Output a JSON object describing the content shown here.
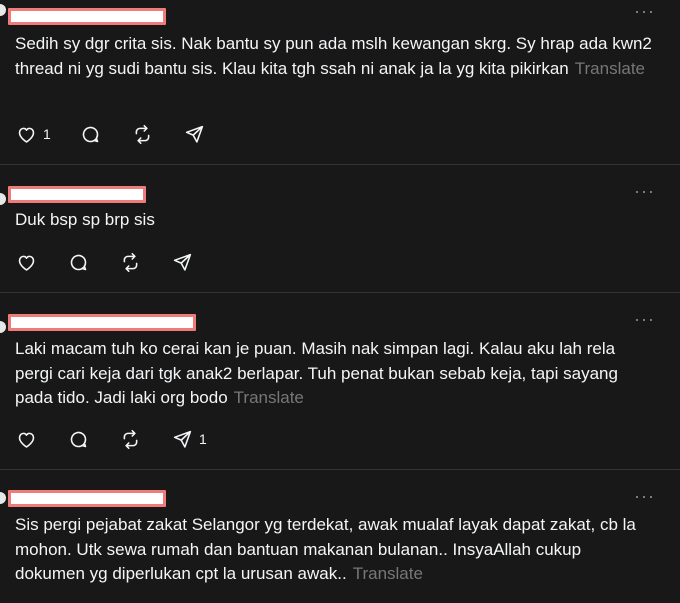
{
  "posts": [
    {
      "text": "Sedih sy dgr crita sis. Nak bantu sy pun ada mslh kewangan skrg. Sy hrap ada kwn2 thread ni yg sudi bantu sis. Klau kita tgh ssah ni anak ja la yg kita pikirkan",
      "translate": "Translate",
      "like_count": "1",
      "repost_count": "",
      "share_count": ""
    },
    {
      "text": "Duk bsp sp brp sis",
      "translate": "",
      "like_count": "",
      "share_count": ""
    },
    {
      "text": "Laki macam tuh ko cerai kan je puan. Masih nak simpan lagi. Kalau aku lah rela pergi cari keja dari tgk anak2 berlapar. Tuh penat bukan sebab keja, tapi sayang pada tido. Jadi laki org bodo",
      "translate": "Translate",
      "like_count": "",
      "share_count": "1"
    },
    {
      "text": "Sis pergi pejabat zakat Selangor yg terdekat, awak mualaf layak dapat zakat, cb la mohon. Utk sewa rumah dan bantuan makanan bulanan.. InsyaAllah cukup dokumen yg diperlukan cpt la urusan awak..",
      "translate": "Translate"
    }
  ],
  "more_glyph": "···",
  "icons": [
    "heart-icon",
    "comment-icon",
    "repost-icon",
    "share-icon",
    "more-icon"
  ]
}
